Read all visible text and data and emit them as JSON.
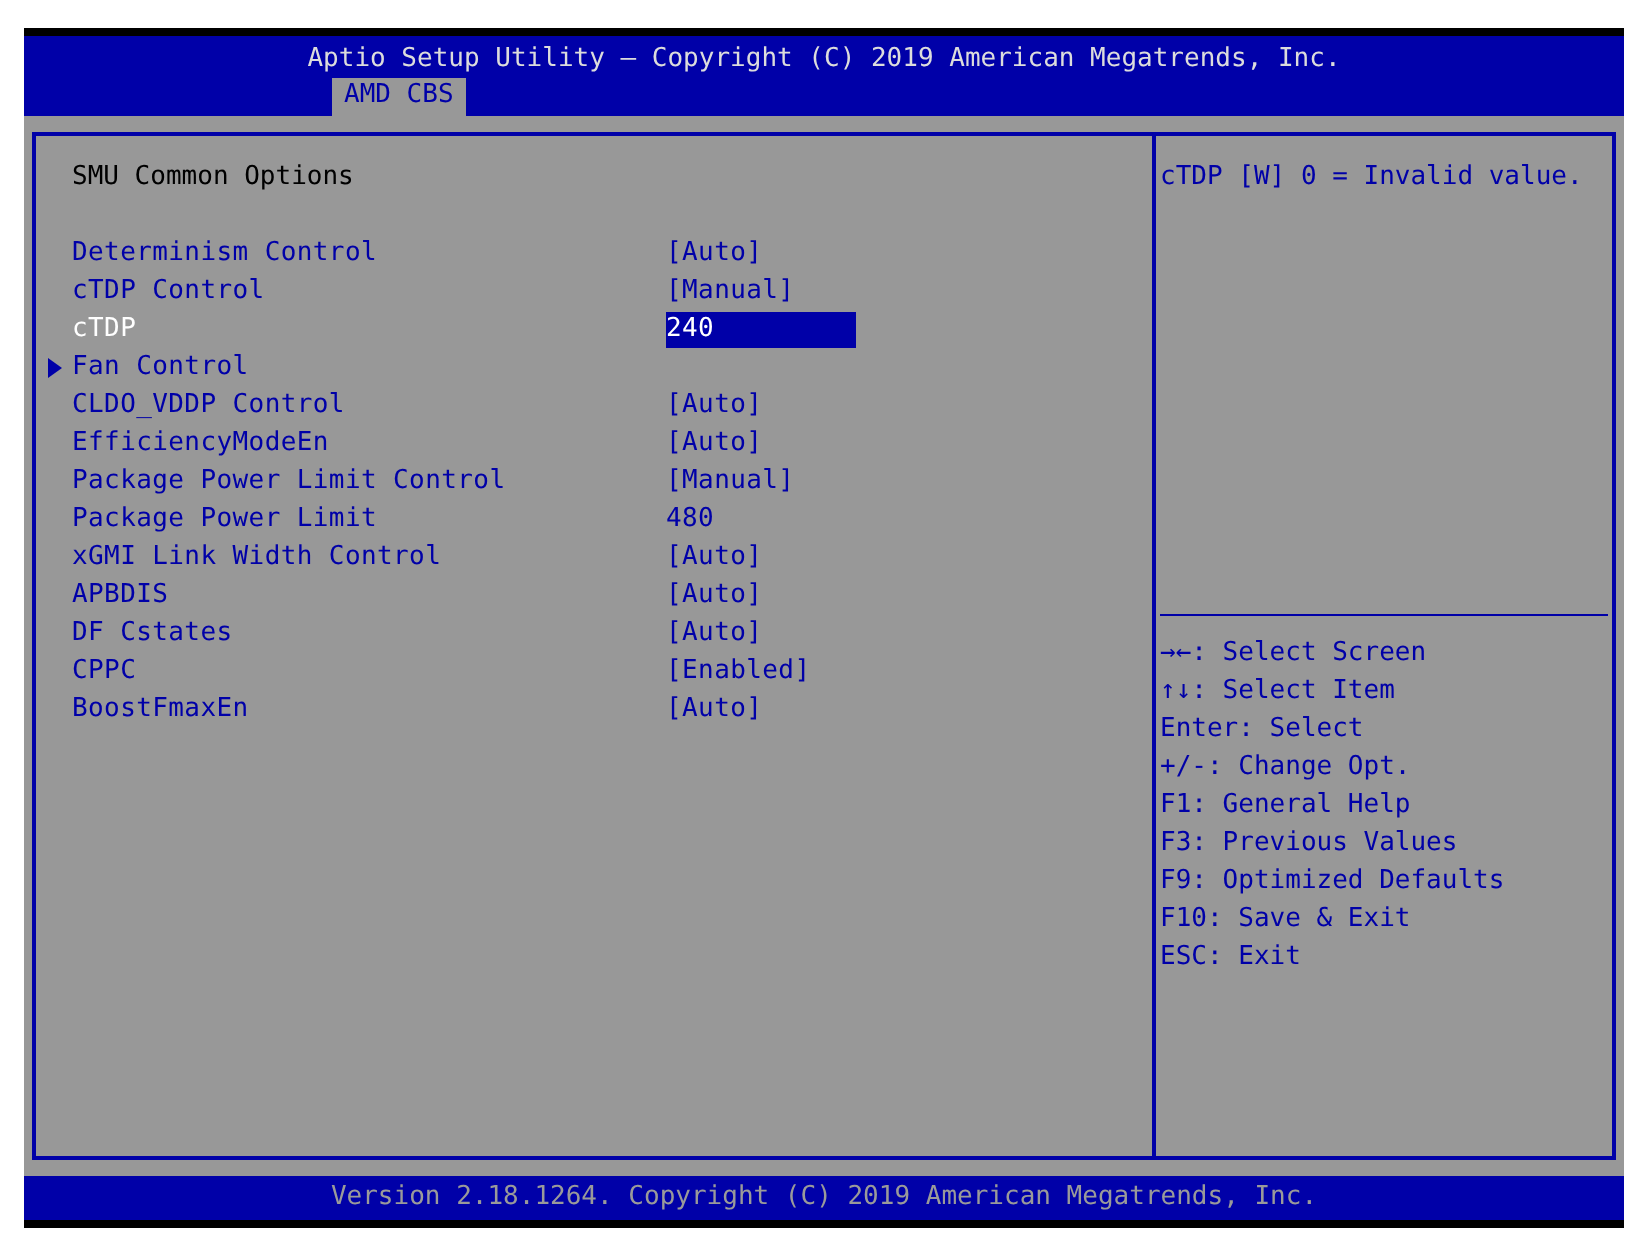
{
  "header": {
    "title": "Aptio Setup Utility – Copyright (C) 2019 American Megatrends, Inc.",
    "tabs": [
      {
        "label": "AMD CBS",
        "selected": true
      }
    ]
  },
  "main": {
    "section_title": "SMU Common Options",
    "items": [
      {
        "kind": "setting",
        "label": "Determinism Control",
        "value": "[Auto]",
        "selected": false
      },
      {
        "kind": "setting",
        "label": "cTDP Control",
        "value": "[Manual]",
        "selected": false
      },
      {
        "kind": "setting",
        "label": "cTDP",
        "value": "240",
        "selected": true
      },
      {
        "kind": "submenu",
        "label": "Fan Control",
        "selected": false
      },
      {
        "kind": "setting",
        "label": "CLDO_VDDP Control",
        "value": "[Auto]",
        "selected": false
      },
      {
        "kind": "setting",
        "label": "EfficiencyModeEn",
        "value": "[Auto]",
        "selected": false
      },
      {
        "kind": "setting",
        "label": "Package Power Limit Control",
        "value": "[Manual]",
        "selected": false
      },
      {
        "kind": "setting",
        "label": "Package Power Limit",
        "value": "480",
        "selected": false
      },
      {
        "kind": "setting",
        "label": "xGMI Link Width Control",
        "value": "[Auto]",
        "selected": false
      },
      {
        "kind": "setting",
        "label": "APBDIS",
        "value": "[Auto]",
        "selected": false
      },
      {
        "kind": "setting",
        "label": "DF Cstates",
        "value": "[Auto]",
        "selected": false
      },
      {
        "kind": "setting",
        "label": "CPPC",
        "value": "[Enabled]",
        "selected": false
      },
      {
        "kind": "setting",
        "label": "BoostFmaxEn",
        "value": "[Auto]",
        "selected": false
      }
    ]
  },
  "help": {
    "text": "cTDP [W] 0 = Invalid value.",
    "keys": [
      "→←: Select Screen",
      "↑↓: Select Item",
      "Enter: Select",
      "+/-: Change Opt.",
      "F1: General Help",
      "F3: Previous Values",
      "F9: Optimized Defaults",
      "F10: Save & Exit",
      "ESC: Exit"
    ]
  },
  "footer": {
    "text": "Version 2.18.1264. Copyright (C) 2019 American Megatrends, Inc."
  }
}
